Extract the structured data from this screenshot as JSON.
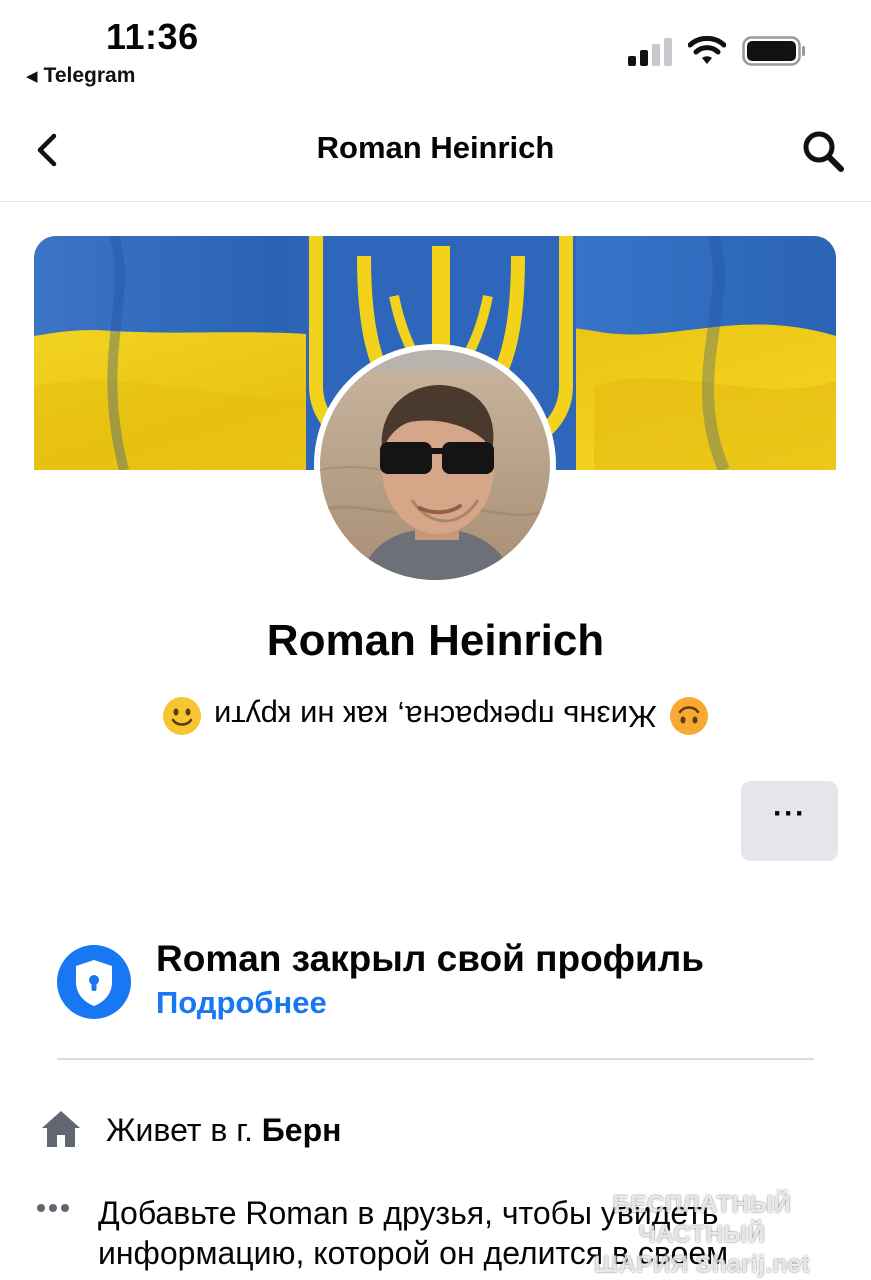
{
  "status_bar": {
    "time": "11:36",
    "back_app": "Telegram"
  },
  "nav": {
    "title": "Roman Heinrich",
    "back_icon": "chevron-left-icon",
    "search_icon": "search-icon"
  },
  "profile": {
    "name": "Roman Heinrich",
    "bio": "Жизнь прекрасна, как ни крути",
    "bio_rendered_upside_down": true,
    "more_label": "···"
  },
  "privacy": {
    "title": "Roman закрыл свой профиль",
    "link": "Подробнее"
  },
  "info": {
    "lives_prefix": "Живет в г.",
    "lives_city": "Берн",
    "add_friend_text": "Добавьте Roman в друзья, чтобы увидеть информацию, которой он делится в своем"
  },
  "watermark": {
    "line1": "БЕСПЛАТНЫЙ ЧАСТНЫЙ",
    "line2": "ШАРИЯ",
    "line3": "Sharij.net"
  },
  "colors": {
    "accent": "#1877f2",
    "flag_blue": "#2f6fc4",
    "flag_yellow": "#f4d21e",
    "button_bg": "#e4e6eb"
  }
}
